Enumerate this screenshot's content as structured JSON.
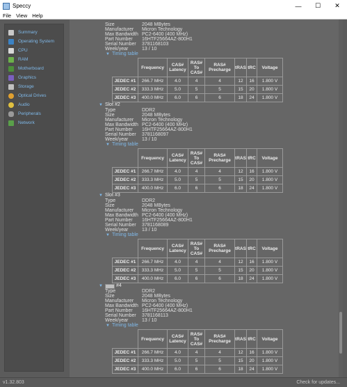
{
  "window": {
    "title": "Speccy",
    "minimize": "—",
    "maximize": "☐",
    "close": "✕"
  },
  "menu": [
    "File",
    "View",
    "Help"
  ],
  "sidebar": [
    {
      "label": "Summary",
      "color": "#c9c9c9"
    },
    {
      "label": "Operating System",
      "color": "#3b82c4"
    },
    {
      "label": "CPU",
      "color": "#d8d8d8"
    },
    {
      "label": "RAM",
      "color": "#6cb14a"
    },
    {
      "label": "Motherboard",
      "color": "#4c8f3a"
    },
    {
      "label": "Graphics",
      "color": "#7a5fc0"
    },
    {
      "label": "Storage",
      "color": "#c0c0c0"
    },
    {
      "label": "Optical Drives",
      "color": "#e0a030"
    },
    {
      "label": "Audio",
      "color": "#e0c040"
    },
    {
      "label": "Peripherals",
      "color": "#9a9a9a"
    },
    {
      "label": "Network",
      "color": "#5aa04a"
    }
  ],
  "labels": {
    "type": "Type",
    "size": "Size",
    "manufacturer": "Manufacturer",
    "bandwidth": "Max Bandwidth",
    "part": "Part Number",
    "serial": "Serial Number",
    "week": "Week/year",
    "timing": "Timing table"
  },
  "table_headers": {
    "freq": "Frequency",
    "cas": [
      "CAS#",
      "Latency"
    ],
    "ras_cas": [
      "RAS#",
      "To",
      "CAS#"
    ],
    "ras_pre": [
      "RAS#",
      "Precharge"
    ],
    "tras": "tRAS",
    "trc": "tRC",
    "voltage": "Voltage"
  },
  "jedec_rows": [
    {
      "name": "JEDEC #1",
      "freq": "266.7 MHz",
      "cas": "4.0",
      "rtc": "4",
      "rp": "4",
      "tras": "12",
      "trc": "16",
      "volt": "1.800 V"
    },
    {
      "name": "JEDEC #2",
      "freq": "333.3 MHz",
      "cas": "5.0",
      "rtc": "5",
      "rp": "5",
      "tras": "15",
      "trc": "20",
      "volt": "1.800 V"
    },
    {
      "name": "JEDEC #3",
      "freq": "400.0 MHz",
      "cas": "6.0",
      "rtc": "6",
      "rp": "6",
      "tras": "18",
      "trc": "24",
      "volt": "1.800 V"
    }
  ],
  "slot1": {
    "size": "2048 MBytes",
    "manufacturer": "Micron Technology",
    "bandwidth": "PC2-6400 (400 MHz)",
    "part": "16HTF25664AZ-800H1",
    "serial": "3781168103",
    "week": "13 / 10"
  },
  "slot2": {
    "title": "Slot #2",
    "type": "DDR2",
    "size": "2048 MBytes",
    "manufacturer": "Micron Technology",
    "bandwidth": "PC2-6400 (400 MHz)",
    "part": "16HTF25664AZ-800H1",
    "serial": "3781168097",
    "week": "13 / 10"
  },
  "slot3": {
    "title": "Slot #3",
    "type": "DDR2",
    "size": "2048 MBytes",
    "manufacturer": "Micron Technology",
    "bandwidth": "PC2-6400 (400 MHz)",
    "part": "16HTF25664AZ-800H1",
    "serial": "3781168089",
    "week": "13 / 10"
  },
  "slot4": {
    "title": "#4",
    "type": "DDR2",
    "size": "2048 MBytes",
    "manufacturer": "Micron Technology",
    "bandwidth": "PC2-6400 (400 MHz)",
    "part": "16HTF25664AZ-800H1",
    "serial": "3781168113",
    "week": "13 / 10"
  },
  "status": {
    "version": "v1.32.803",
    "update": "Check for updates..."
  }
}
